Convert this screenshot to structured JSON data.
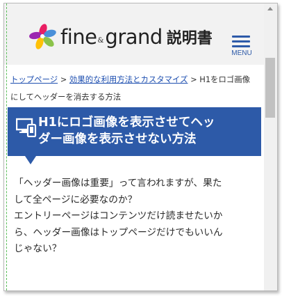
{
  "header": {
    "logo_fine": "fine",
    "logo_amp": "&",
    "logo_grand": "grand",
    "logo_manual": "説明書",
    "menu_label": "MENU"
  },
  "breadcrumb": {
    "items": [
      "トップページ",
      "効果的な利用方法とカスタマイズ"
    ],
    "separator": ">",
    "current": "H1をロゴ画像にしてヘッダーを消去する方法"
  },
  "article": {
    "title_line1": "H1にロゴ画像を表示させてヘッ",
    "title_line2": "ダー画像を表示させない方法",
    "body_lines": [
      "「ヘッダー画像は重要」って言われますが、果た",
      "して全ページに必要なのか？",
      "エントリーページはコンテンツだけ読ませたいか",
      "ら、ヘッダー画像はトップページだけでもいいん",
      "じゃない？"
    ]
  },
  "colors": {
    "accent": "#2d5aa8",
    "link": "#1e4fb0",
    "header_bg": "#f2f2f2"
  },
  "icons": {
    "title": "devices-icon",
    "menu": "hamburger-icon",
    "logo": "flower-logo-icon"
  }
}
